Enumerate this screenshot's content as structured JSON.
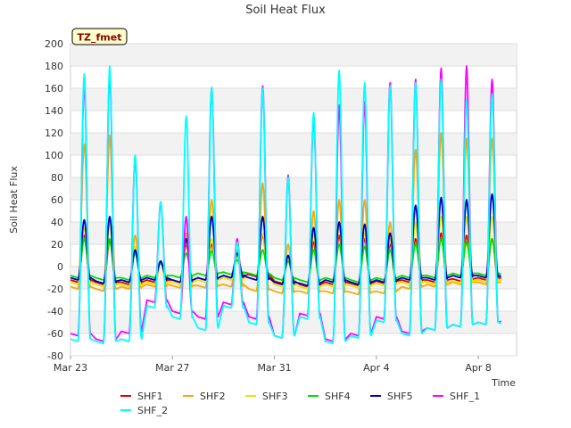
{
  "chart_data": {
    "type": "line",
    "title": "Soil Heat Flux",
    "xlabel": "Time",
    "ylabel": "Soil Heat Flux",
    "ylim": [
      -80,
      200
    ],
    "xlim": [
      0,
      17.5
    ],
    "yticks": [
      -80,
      -60,
      -40,
      -20,
      0,
      20,
      40,
      60,
      80,
      100,
      120,
      140,
      160,
      180,
      200
    ],
    "xticks": [
      {
        "label": "Mar 23",
        "day": 0
      },
      {
        "label": "Mar 27",
        "day": 4
      },
      {
        "label": "Mar 31",
        "day": 8
      },
      {
        "label": "Apr 4",
        "day": 12
      },
      {
        "label": "Apr 8",
        "day": 16
      }
    ],
    "grid": true,
    "legend_position": "bottom",
    "annotation": "TZ_fmet",
    "days": [
      "Mar 23",
      "Mar 24",
      "Mar 25",
      "Mar 26",
      "Mar 27",
      "Mar 28",
      "Mar 29",
      "Mar 30",
      "Mar 31",
      "Apr 1",
      "Apr 2",
      "Apr 3",
      "Apr 4",
      "Apr 5",
      "Apr 6",
      "Apr 7",
      "Apr 8",
      "Apr 9"
    ],
    "peak_hour": 13,
    "series": [
      {
        "name": "SHF1",
        "color": "#dd0000",
        "night": [
          -12,
          -14,
          -14,
          -12,
          -12,
          -10,
          -8,
          -7,
          -13,
          -16,
          -14,
          -15,
          -13,
          -12,
          -12,
          -11,
          -10,
          -11
        ],
        "peak": [
          28,
          24,
          15,
          5,
          20,
          20,
          10,
          28,
          10,
          22,
          28,
          25,
          20,
          25,
          30,
          28,
          25,
          15
        ]
      },
      {
        "name": "SHF2",
        "color": "#ffa500",
        "night": [
          -18,
          -20,
          -18,
          -16,
          -17,
          -17,
          -16,
          -20,
          -22,
          -22,
          -22,
          -23,
          -22,
          -18,
          -16,
          -14,
          -14,
          -14
        ],
        "peak": [
          110,
          118,
          28,
          5,
          30,
          60,
          15,
          75,
          20,
          50,
          60,
          60,
          40,
          105,
          120,
          115,
          115,
          30
        ]
      },
      {
        "name": "SHF3",
        "color": "#e6e600",
        "night": [
          -14,
          -16,
          -16,
          -14,
          -14,
          -12,
          -10,
          -10,
          -16,
          -18,
          -16,
          -17,
          -15,
          -14,
          -14,
          -13,
          -12,
          -13
        ],
        "peak": [
          35,
          40,
          18,
          5,
          22,
          25,
          10,
          30,
          10,
          30,
          35,
          30,
          25,
          40,
          45,
          45,
          45,
          18
        ]
      },
      {
        "name": "SHF4",
        "color": "#00dd00",
        "night": [
          -8,
          -10,
          -10,
          -8,
          -8,
          -6,
          -5,
          -6,
          -10,
          -12,
          -10,
          -12,
          -10,
          -8,
          -8,
          -6,
          -6,
          -8
        ],
        "peak": [
          25,
          25,
          12,
          3,
          12,
          14,
          6,
          15,
          5,
          15,
          20,
          18,
          15,
          20,
          25,
          22,
          25,
          10
        ]
      },
      {
        "name": "SHF5",
        "color": "#0000bb",
        "night": [
          -10,
          -13,
          -12,
          -10,
          -12,
          -10,
          -8,
          -10,
          -14,
          -15,
          -12,
          -14,
          -12,
          -10,
          -10,
          -8,
          -8,
          -10
        ],
        "peak": [
          42,
          45,
          15,
          5,
          25,
          45,
          12,
          45,
          10,
          35,
          40,
          38,
          30,
          55,
          62,
          60,
          65,
          20
        ]
      },
      {
        "name": "SHF_1",
        "color": "#ff00ff",
        "night": [
          -60,
          -65,
          -58,
          -30,
          -40,
          -45,
          -32,
          -45,
          -62,
          -42,
          -65,
          -60,
          -45,
          -58,
          -55,
          -52,
          -50,
          -48
        ],
        "peak": [
          165,
          175,
          98,
          58,
          45,
          160,
          25,
          162,
          82,
          135,
          145,
          148,
          165,
          168,
          178,
          180,
          168,
          60
        ]
      },
      {
        "name": "SHF_2",
        "color": "#00ffff",
        "night": [
          -65,
          -67,
          -65,
          -35,
          -45,
          -55,
          -35,
          -50,
          -62,
          -45,
          -67,
          -62,
          -48,
          -60,
          -55,
          -52,
          -50,
          -52
        ],
        "peak": [
          173,
          180,
          100,
          58,
          135,
          161,
          22,
          160,
          80,
          138,
          176,
          165,
          162,
          165,
          168,
          150,
          155,
          60
        ]
      }
    ]
  }
}
